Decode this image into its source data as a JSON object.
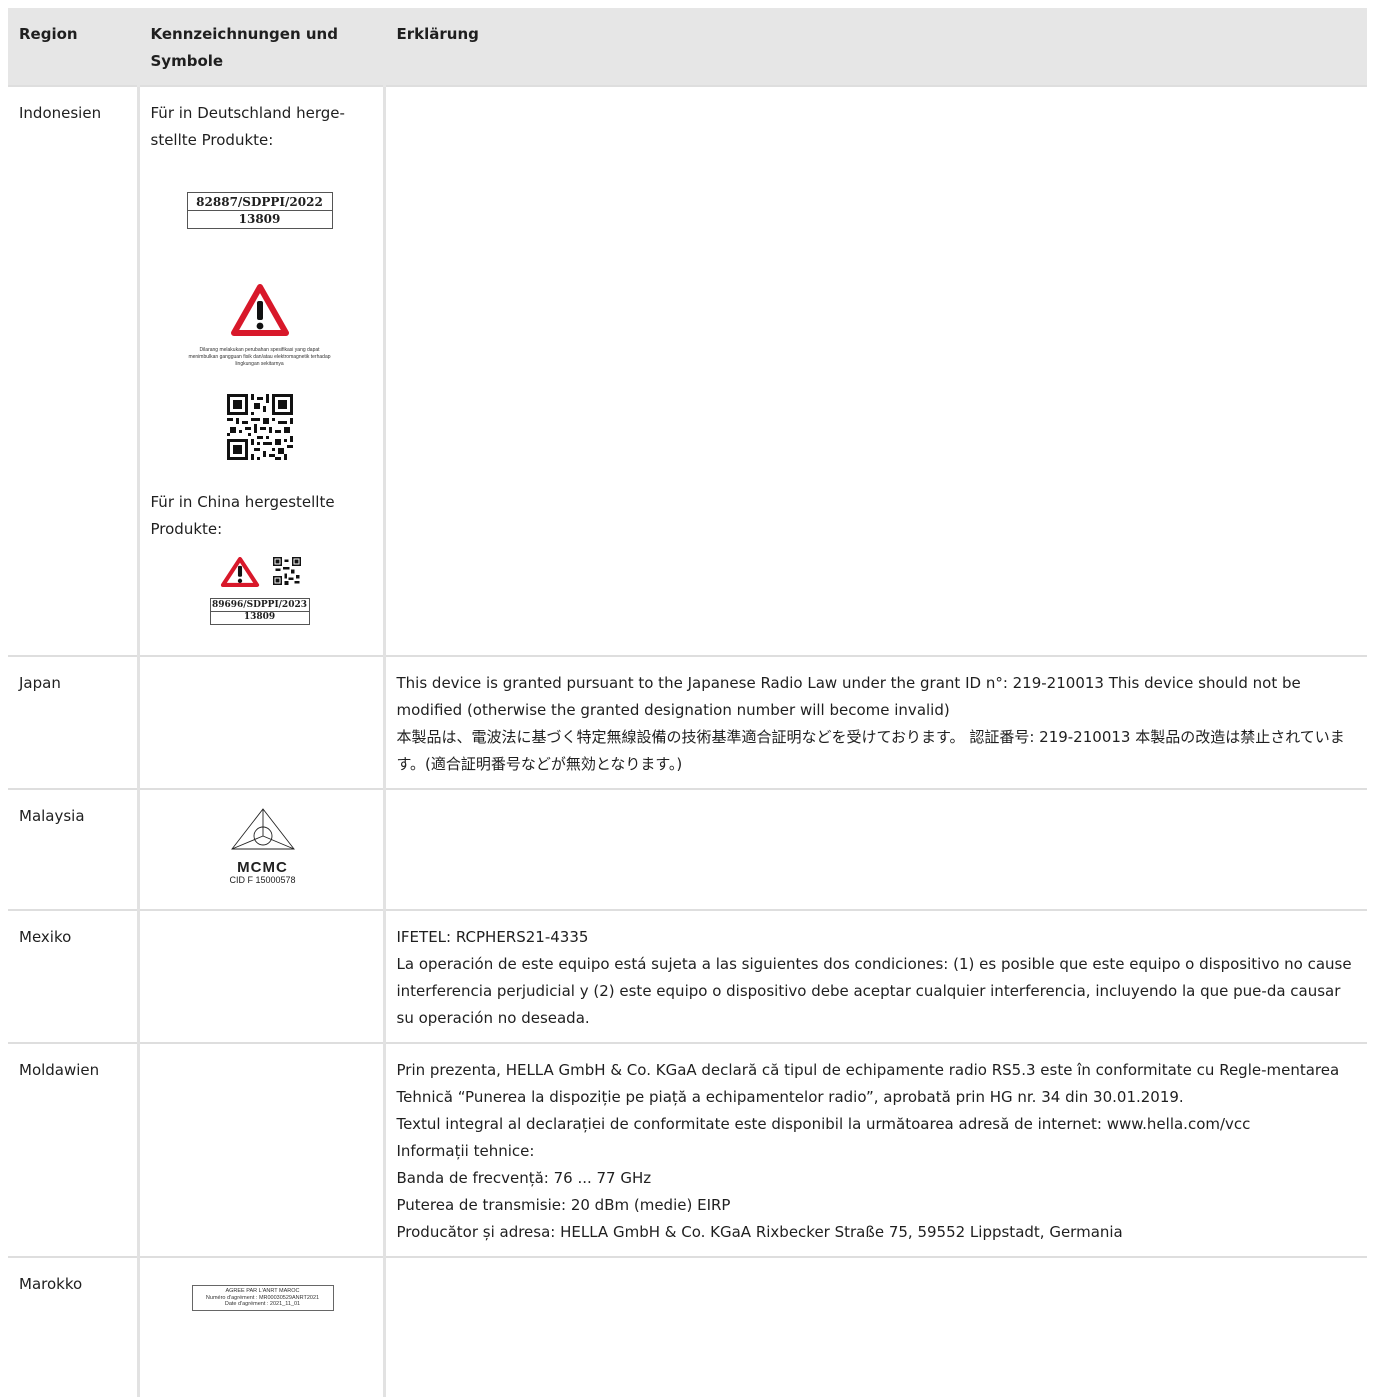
{
  "header": {
    "col_region": "Region",
    "col_symbols": "Kennzeichnungen und Symbole",
    "col_explanation": "Erklärung"
  },
  "rows": {
    "indonesia": {
      "region": "Indonesien",
      "germany_note": "Für in Deutschland herge-stellte Produkte:",
      "label_de_line1": "82887/SDPPI/2022",
      "label_de_line2": "13809",
      "warning_text": "Dilarang melakukan perubahan spesifikasi yang dapat menimbulkan gangguan fisik dan/atau elektromagnetik terhadap lingkungan sekitarnya",
      "china_note": "Für in China hergestellte Produkte:",
      "label_cn_line1": "89696/SDPPI/2023",
      "label_cn_line2": "13809"
    },
    "japan": {
      "region": "Japan",
      "text_en": "This device is granted pursuant to the Japanese Radio Law under the grant ID n°: 219-210013 This device should not be modified (otherwise the granted designation number will become invalid)",
      "text_ja": "本製品は、電波法に基づく特定無線設備の技術基準適合証明などを受けております。 認証番号: 219-210013 本製品の改造は禁止されています。(適合証明番号などが無効となります。)"
    },
    "malaysia": {
      "region": "Malaysia",
      "logo_label": "MCMC",
      "cid": "CID F 15000578"
    },
    "mexico": {
      "region": "Mexiko",
      "line1": "IFETEL: RCPHERS21-4335",
      "line2": "La operación de este equipo está sujeta a las siguientes dos condiciones: (1) es posible que este equipo o dispositivo no cause interferencia perjudicial y (2) este equipo o dispositivo debe aceptar cualquier interferencia, incluyendo la que pue-da causar su operación no deseada."
    },
    "moldova": {
      "region": "Moldawien",
      "line1": "Prin prezenta, HELLA GmbH & Co. KGaA declară că tipul de echipamente radio RS5.3 este în conformitate cu Regle-mentarea Tehnică “Punerea la dispoziție pe piață a echipamentelor radio”, aprobată prin HG nr. 34 din 30.01.2019.",
      "line2": "Textul integral al declarației de conformitate este disponibil la următoarea adresă de internet: www.hella.com/vcc",
      "line3": "Informații tehnice:",
      "line4": "Banda de frecvență: 76 ... 77 GHz",
      "line5": "Puterea de transmisie: 20 dBm (medie) EIRP",
      "line6": "Producător și adresa: HELLA GmbH & Co. KGaA Rixbecker Straße 75, 59552 Lippstadt, Germania"
    },
    "morocco": {
      "region": "Marokko",
      "anrt_line1": "AGREE PAR L'ANRT MAROC",
      "anrt_line2": "Numéro d'agrément : MR00030529ANRT2021",
      "anrt_line3": "Date d'agrément : 2021_11_01"
    }
  }
}
